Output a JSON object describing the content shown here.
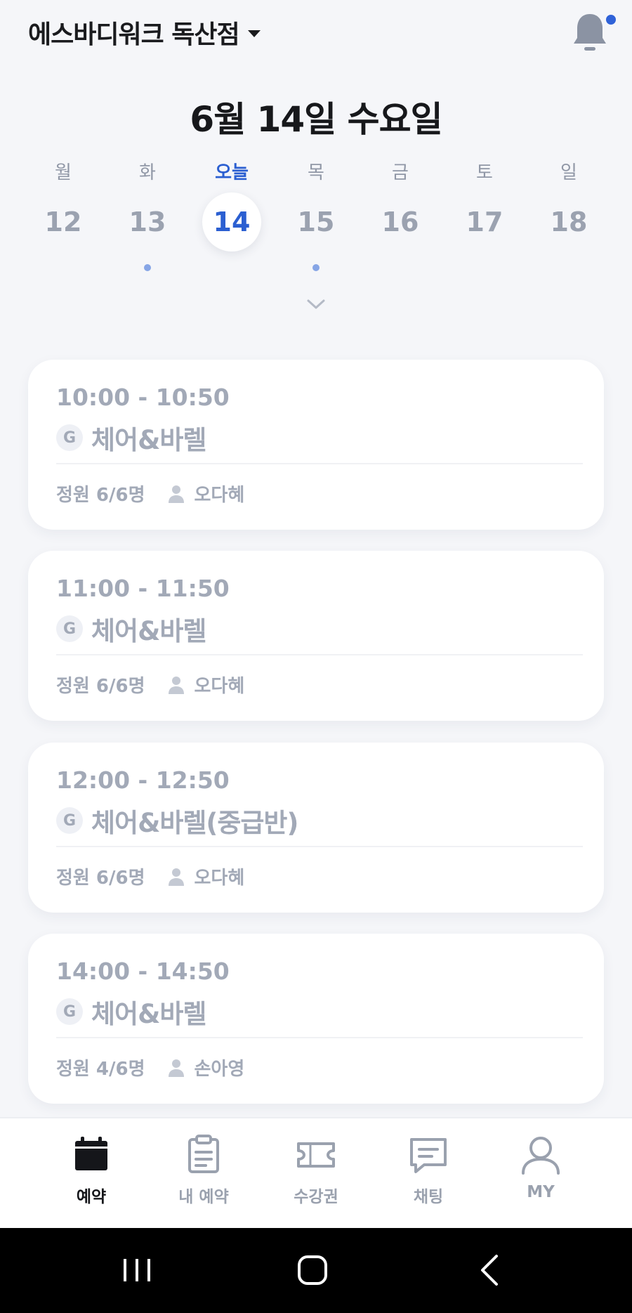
{
  "header": {
    "studio_name": "에스바디워크 독산점",
    "notification_badge_color": "#2f62d8"
  },
  "date_title": "6월 14일 수요일",
  "week": {
    "days": [
      {
        "label": "월",
        "num": "12",
        "has_classes": false,
        "is_today": false
      },
      {
        "label": "화",
        "num": "13",
        "has_classes": true,
        "is_today": false
      },
      {
        "label": "오늘",
        "num": "14",
        "has_classes": false,
        "is_today": true
      },
      {
        "label": "목",
        "num": "15",
        "has_classes": true,
        "is_today": false
      },
      {
        "label": "금",
        "num": "16",
        "has_classes": false,
        "is_today": false
      },
      {
        "label": "토",
        "num": "17",
        "has_classes": false,
        "is_today": false
      },
      {
        "label": "일",
        "num": "18",
        "has_classes": false,
        "is_today": false
      }
    ],
    "expand_icon": "chevron-down-icon"
  },
  "classes": [
    {
      "time": "10:00 - 10:50",
      "badge": "G",
      "name": "체어&바렐",
      "capacity": "정원 6/6명",
      "instructor": "오다혜"
    },
    {
      "time": "11:00 - 11:50",
      "badge": "G",
      "name": "체어&바렐",
      "capacity": "정원 6/6명",
      "instructor": "오다혜"
    },
    {
      "time": "12:00 - 12:50",
      "badge": "G",
      "name": "체어&바렐(중급반)",
      "capacity": "정원 6/6명",
      "instructor": "오다혜"
    },
    {
      "time": "14:00 - 14:50",
      "badge": "G",
      "name": "체어&바렐",
      "capacity": "정원 4/6명",
      "instructor": "손아영"
    }
  ],
  "bottom_nav": {
    "items": [
      {
        "label": "예약",
        "icon": "calendar-icon",
        "active": true
      },
      {
        "label": "내 예약",
        "icon": "clipboard-icon",
        "active": false
      },
      {
        "label": "수강권",
        "icon": "ticket-icon",
        "active": false
      },
      {
        "label": "채팅",
        "icon": "chat-icon",
        "active": false
      },
      {
        "label": "MY",
        "icon": "user-icon",
        "active": false
      }
    ]
  },
  "colors": {
    "accent": "#2b5fd1",
    "background": "#f5f6f9",
    "muted_text": "#a2a9b7"
  }
}
